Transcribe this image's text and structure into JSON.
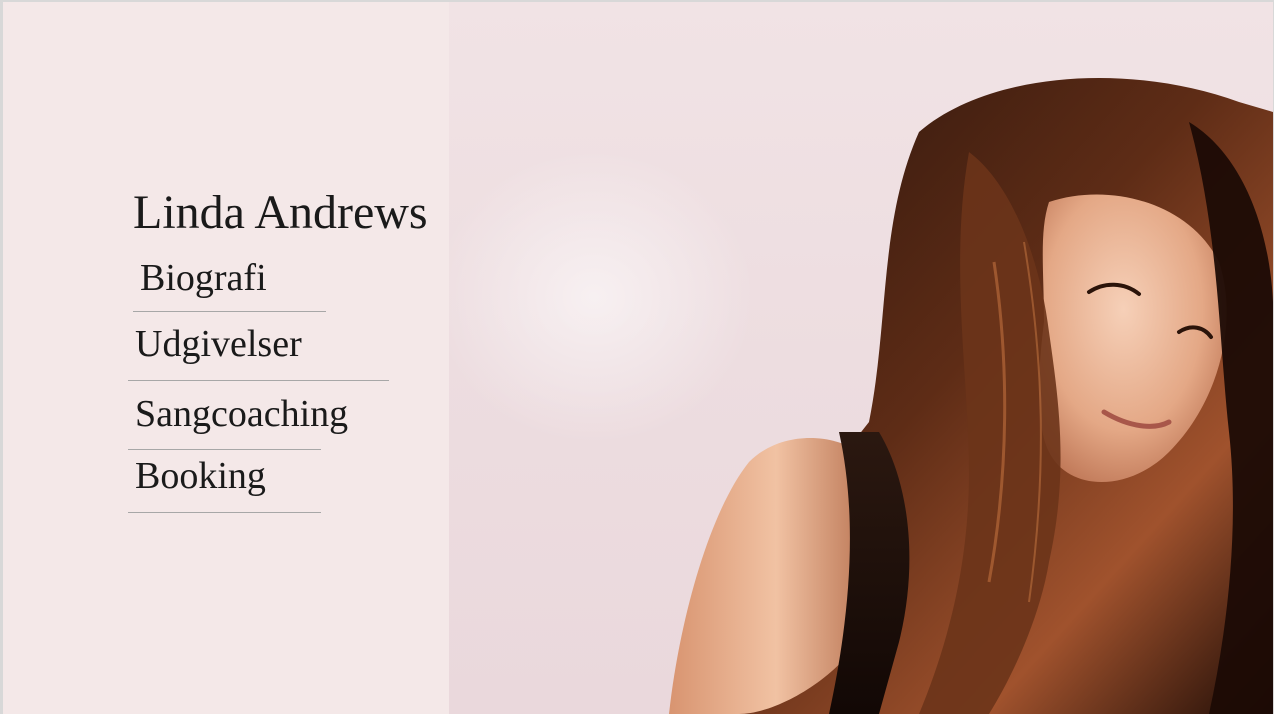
{
  "site": {
    "title": "Linda Andrews"
  },
  "nav": {
    "items": [
      {
        "label": "Biografi"
      },
      {
        "label": "Udgivelser"
      },
      {
        "label": "Sangcoaching"
      },
      {
        "label": "Booking"
      }
    ]
  },
  "colors": {
    "background": "#f4e8e8",
    "text": "#1a1a1a",
    "divider": "#a7a7a7"
  }
}
